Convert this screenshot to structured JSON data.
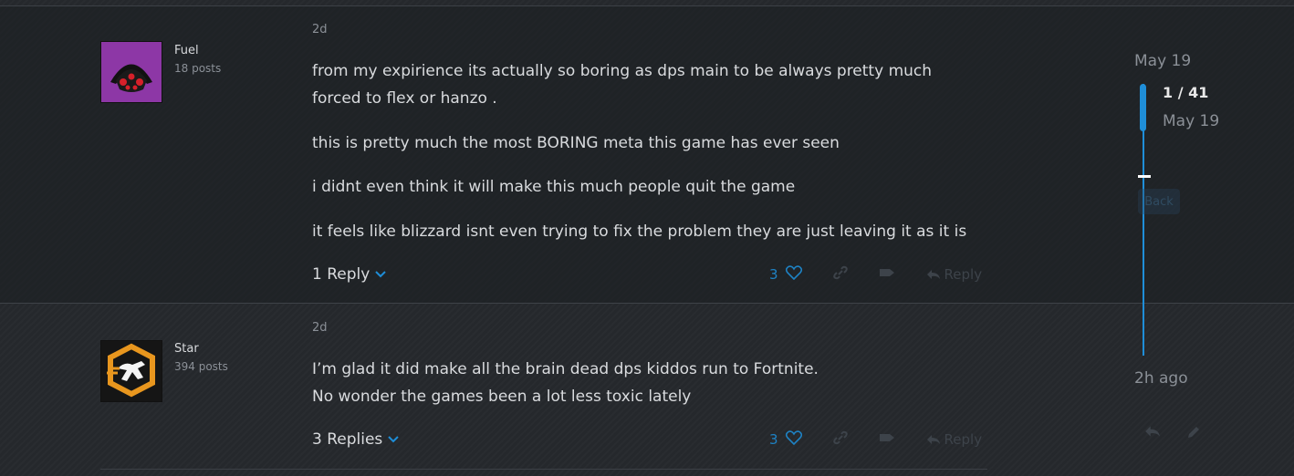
{
  "posts": [
    {
      "username": "Fuel",
      "post_count": "18 posts",
      "date": "2d",
      "paragraphs": [
        "from my expirience its actually so boring as dps main to be always pretty much forced to flex or hanzo .",
        "this is pretty much the most BORING meta this game has ever seen",
        "i didnt even think it will make this much people quit the game",
        "it feels like blizzard isnt even trying to fix the problem they are just leaving it as it is"
      ],
      "replies_label": "1 Reply",
      "like_count": "3",
      "reply_button": "Reply"
    },
    {
      "username": "Star",
      "post_count": "394 posts",
      "date": "2d",
      "paragraphs": [
        "I’m glad it did make all the brain dead dps kiddos run to Fortnite.",
        "No wonder the games been a lot less toxic lately"
      ],
      "replies_label": "3 Replies",
      "like_count": "3",
      "reply_button": "Reply"
    }
  ],
  "timeline": {
    "top_date": "May 19",
    "position": "1 / 41",
    "position_date": "May 19",
    "back_label": "Back",
    "bottom_date": "2h ago"
  },
  "icons": {
    "chevron": "chevron-down-icon",
    "like": "heart-icon",
    "link": "link-icon",
    "flag": "flag-icon",
    "reply": "reply-icon"
  },
  "colors": {
    "accent": "#1e8ed8",
    "background": "#25282c",
    "avatar_fuel": "#8d37a6",
    "avatar_star_ring": "#e8961e"
  }
}
